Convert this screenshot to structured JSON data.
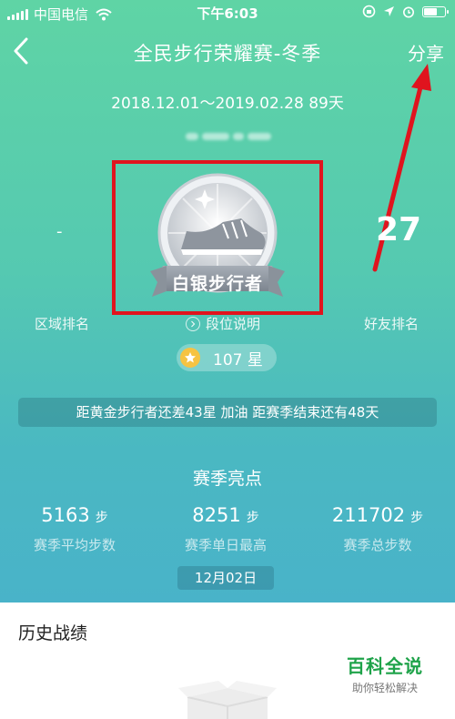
{
  "status_bar": {
    "carrier": "中国电信",
    "time": "下午6:03"
  },
  "nav": {
    "title": "全民步行荣耀赛-冬季",
    "share_label": "分享"
  },
  "season_dates": "2018.12.01～2019.02.28 89天",
  "badge": {
    "label": "白银步行者"
  },
  "rankings": {
    "region_value": "-",
    "friends_value": "27",
    "region_label": "区域排名",
    "level_label": "段位说明",
    "friends_label": "好友排名"
  },
  "stars": {
    "text": "107 星",
    "color": "#f6c343"
  },
  "tip": "距黄金步行者还差43星 加油 距赛季结束还有48天",
  "highlights": {
    "title": "赛季亮点",
    "stats": [
      {
        "value": "5163",
        "unit": "步",
        "caption": "赛季平均步数"
      },
      {
        "value": "8251",
        "unit": "步",
        "caption": "赛季单日最高"
      },
      {
        "value": "211702",
        "unit": "步",
        "caption": "赛季总步数"
      }
    ],
    "date_chip": "12月02日"
  },
  "history": {
    "title": "历史战绩"
  },
  "watermark": {
    "main": "百科全说",
    "sub": "助你轻松解决"
  },
  "annotation_color": "#e0141e"
}
